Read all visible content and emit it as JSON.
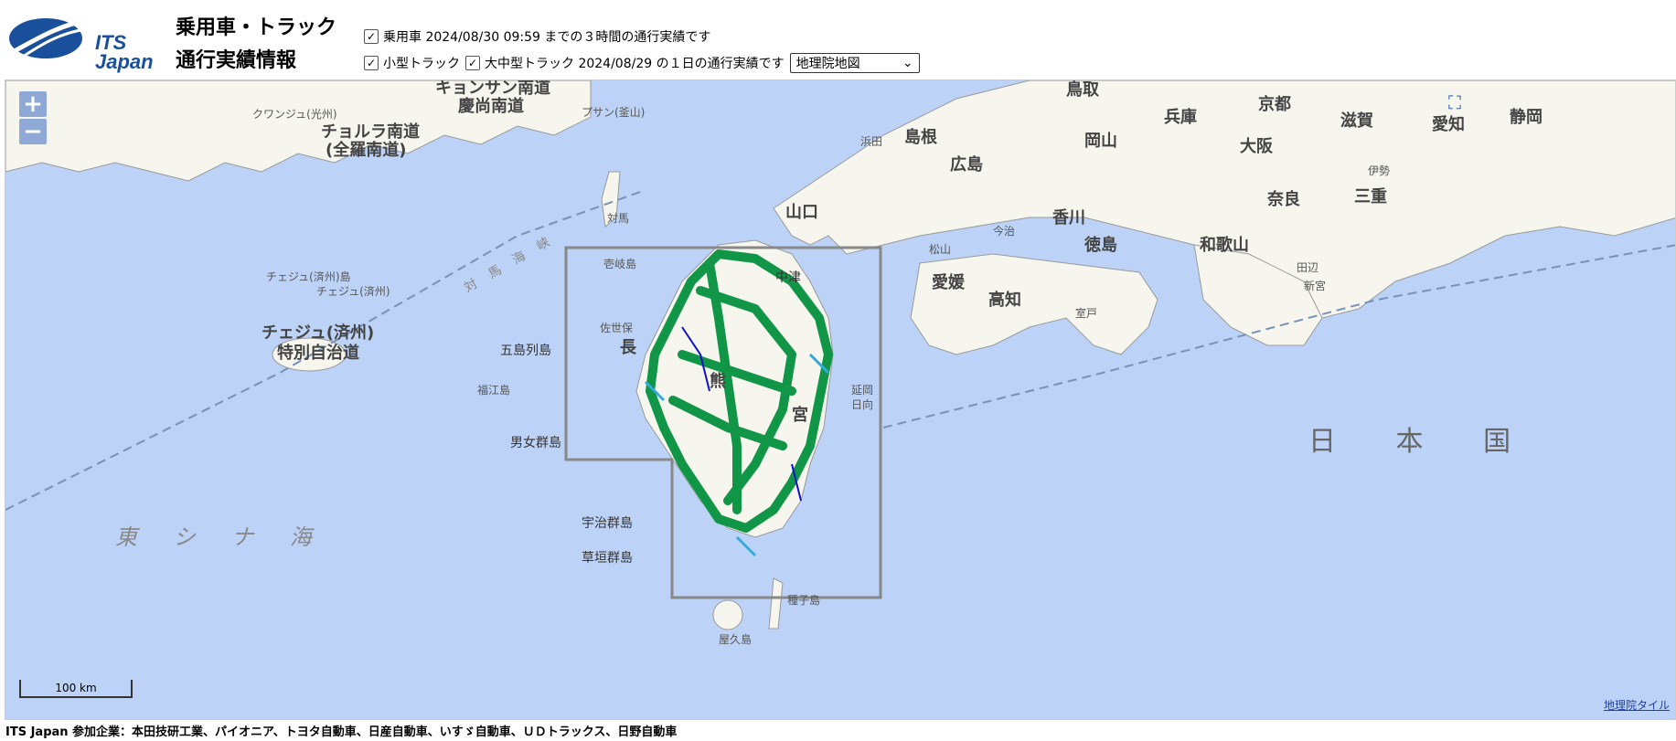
{
  "header": {
    "logo_text_line1": "ITS",
    "logo_text_line2": "Japan",
    "title_line1": "乗用車・トラック",
    "title_line2": "通行実績情報",
    "row1": {
      "checkbox_checked": true,
      "text": "乗用車 2024/08/30 09:59 までの３時間の通行実績です"
    },
    "row2": {
      "small_truck_checked": true,
      "small_truck_label": "小型トラック",
      "large_truck_checked": true,
      "text": "大中型トラック 2024/08/29 の１日の通行実績です",
      "map_select_value": "地理院地図"
    }
  },
  "map": {
    "zoom_in_label": "+",
    "zoom_out_label": "−",
    "scale_label": "100 km",
    "attribution": "地理院タイル",
    "colors": {
      "sea": "#bcd3f7",
      "land": "#f6f6ef",
      "passenger_car": "#109646",
      "small_truck": "#33aadd",
      "large_truck": "#1010c8",
      "region_box": "#888888"
    },
    "labels": {
      "nihonkoku": "日 本 国",
      "higashi_shinakai": "東 シ ナ 海",
      "tsushima_kaikyo": "対 馬 海 峡",
      "jeju": "チェジュ(済州)",
      "jeju_special": "特別自治道",
      "jeju_island": "チェジュ(済州)島",
      "jeju_city": "チェジュ(済州)",
      "kyongsang_nam": "キョンサン南道",
      "kyongsang_nam_kanji": "慶尚南道",
      "jeolla_nam": "チョルラ南道",
      "jeolla_nam_kanji": "(全羅南道)",
      "busan": "プサン(釜山)",
      "gwangju": "クワンジュ(光州)",
      "goto": "五島列島",
      "danjo": "男女群島",
      "uji": "宇治群島",
      "kusagaki": "草垣群島",
      "tsushima": "対馬",
      "iki": "壱岐島",
      "shimane": "島根",
      "hiroshima": "広島",
      "yamaguchi": "山口",
      "tottori": "鳥取",
      "okayama": "岡山",
      "hyogo": "兵庫",
      "kyoto": "京都",
      "osaka": "大阪",
      "nara": "奈良",
      "shiga": "滋賀",
      "mie": "三重",
      "aichi": "愛知",
      "shizuoka": "静岡",
      "wakayama": "和歌山",
      "tokushima": "徳島",
      "kagawa": "香川",
      "ehime": "愛媛",
      "kochi": "高知",
      "miyazaki": "宮",
      "yakushima": "屋久島",
      "tanegashima": "種子島",
      "nakatsu": "中津",
      "kumamoto": "熊",
      "nagasaki": "長",
      "sasebo": "佐世保",
      "fukue": "福江島",
      "nobeoka": "延岡",
      "hyuga": "日向",
      "tanabe": "田辺",
      "shingu": "新宮",
      "muroto": "室戸",
      "imabari": "今治",
      "matsuyama": "松山",
      "ise": "伊勢",
      "hamada": "浜田"
    }
  },
  "footer": {
    "text": "ITS Japan 参加企業：本田技研工業、パイオニア、トヨタ自動車、日産自動車、いすゞ自動車、ＵＤトラックス、日野自動車"
  }
}
